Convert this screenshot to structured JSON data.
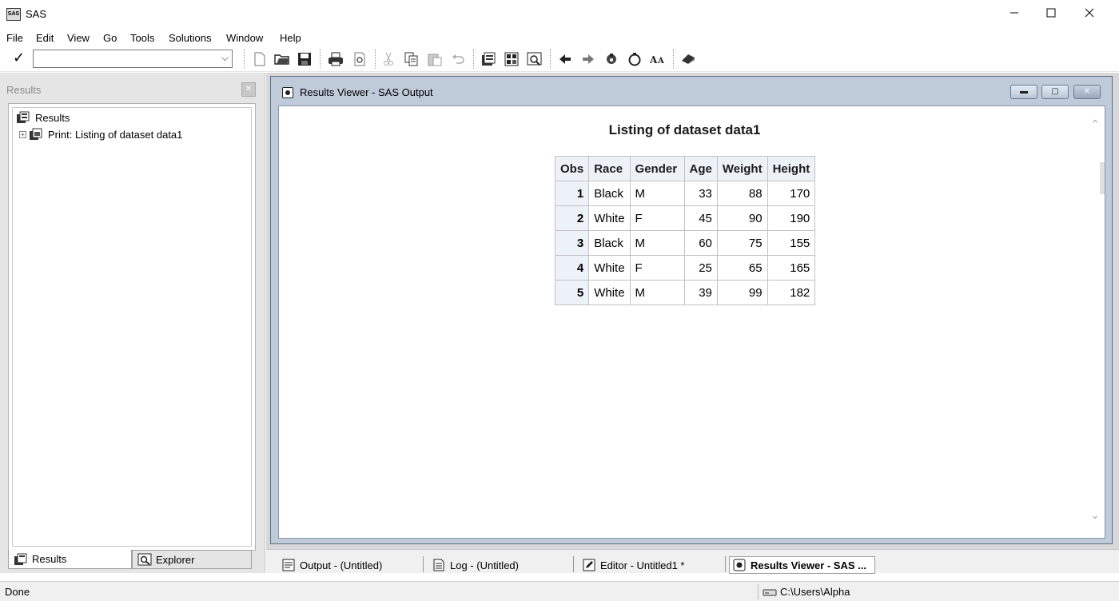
{
  "window": {
    "title": "SAS",
    "icon_text": "SAS",
    "minimize_icon": "minimize-icon",
    "maximize_icon": "maximize-icon",
    "close_icon": "close-icon"
  },
  "menu": [
    "File",
    "Edit",
    "View",
    "Go",
    "Tools",
    "Solutions",
    "Window",
    "Help"
  ],
  "toolbar": {
    "command_value": "",
    "icons": [
      "new-icon",
      "open-icon",
      "save-icon",
      "print-icon",
      "print-preview-icon",
      "cut-icon",
      "copy-icon",
      "paste-icon",
      "undo-icon",
      "new-library-icon",
      "sas-explorer-icon",
      "query-icon",
      "back-icon",
      "forward-icon",
      "help-icon",
      "clear-icon",
      "font-icon",
      "book-icon"
    ]
  },
  "left_panel": {
    "title": "Results",
    "tree": {
      "root": "Results",
      "child": "Print:  Listing of dataset data1"
    },
    "tabs": [
      "Results",
      "Explorer"
    ]
  },
  "results_viewer": {
    "title": "Results Viewer - SAS Output",
    "report_title": "Listing of dataset data1",
    "columns": [
      "Obs",
      "Race",
      "Gender",
      "Age",
      "Weight",
      "Height"
    ],
    "rows": [
      [
        "1",
        "Black",
        "M",
        "33",
        "88",
        "170"
      ],
      [
        "2",
        "White",
        "F",
        "45",
        "90",
        "190"
      ],
      [
        "3",
        "Black",
        "M",
        "60",
        "75",
        "155"
      ],
      [
        "4",
        "White",
        "F",
        "25",
        "65",
        "165"
      ],
      [
        "5",
        "White",
        "M",
        "39",
        "99",
        "182"
      ]
    ]
  },
  "window_tabs": [
    "Output - (Untitled)",
    "Log - (Untitled)",
    "Editor - Untitled1 *",
    "Results Viewer - SAS ..."
  ],
  "status": {
    "text": "Done",
    "path": "C:\\Users\\Alpha"
  }
}
